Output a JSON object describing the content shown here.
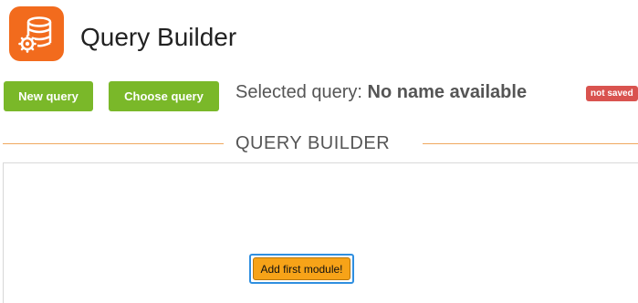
{
  "header": {
    "title": "Query Builder",
    "logo_icon": "database-gear-icon",
    "logo_color": "#f26b1d"
  },
  "toolbar": {
    "new_query_label": "New query",
    "choose_query_label": "Choose query",
    "button_color": "#7ab829",
    "selected_query_prefix": "Selected query:",
    "selected_query_name": "No name available",
    "status_badge": "not saved",
    "status_badge_color": "#d9534f"
  },
  "builder": {
    "section_title": "QUERY BUILDER",
    "add_module_label": "Add first module!",
    "add_module_color": "#f7a318"
  }
}
